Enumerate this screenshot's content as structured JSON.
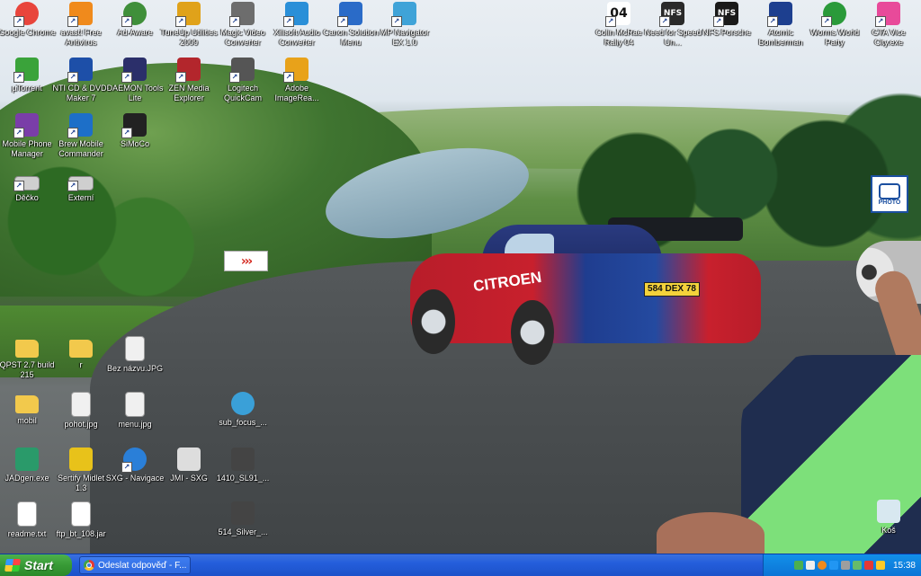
{
  "desktop": {
    "icons": [
      {
        "label": "Google Chrome",
        "icon": "chrome-icon",
        "color": "#e8453c",
        "shortcut": true
      },
      {
        "label": "avast! Free Antivirus",
        "icon": "avast-icon",
        "color": "#f08a1c",
        "shortcut": true
      },
      {
        "label": "Ad-Aware",
        "icon": "ad-aware-icon",
        "color": "#3f8f3a",
        "shortcut": true
      },
      {
        "label": "TuneUp Utilities 2009",
        "icon": "tuneup-icon",
        "color": "#e0a21a",
        "shortcut": true
      },
      {
        "label": "Magic Video Converter",
        "icon": "film-reel-icon",
        "color": "#6d6d6d",
        "shortcut": true
      },
      {
        "label": "Xilisoft Audio Converter",
        "icon": "audio-converter-icon",
        "color": "#2a8fd8",
        "shortcut": true
      },
      {
        "label": "Canon Solution Menu",
        "icon": "canon-icon",
        "color": "#2a6bc8",
        "shortcut": true
      },
      {
        "label": "MP Navigator EX 1.0",
        "icon": "mp-navigator-icon",
        "color": "#3fa3d8",
        "shortcut": true
      },
      {
        "label": "µTorrent",
        "icon": "utorrent-icon",
        "color": "#3aa33a",
        "shortcut": true
      },
      {
        "label": "NTI CD & DVD-Maker 7",
        "icon": "nti-icon",
        "color": "#1d4fa8",
        "shortcut": true
      },
      {
        "label": "DAEMON Tools Lite",
        "icon": "daemon-tools-icon",
        "color": "#2b2f6a",
        "shortcut": true
      },
      {
        "label": "ZEN Media Explorer",
        "icon": "zen-media-icon",
        "color": "#b3262c",
        "shortcut": true
      },
      {
        "label": "Logitech QuickCam",
        "icon": "webcam-icon",
        "color": "#555555",
        "shortcut": true
      },
      {
        "label": "Adobe ImageRea...",
        "icon": "adobe-icon",
        "color": "#e8a21a",
        "shortcut": true
      },
      {
        "label": "Mobile Phone Manager",
        "icon": "mpm-icon",
        "color": "#7a3ea8",
        "shortcut": true
      },
      {
        "label": "Brew Mobile Commander",
        "icon": "bmc-icon",
        "color": "#1d6fc8",
        "shortcut": true
      },
      {
        "label": "SiMoCo",
        "icon": "phone-icon",
        "color": "#222222",
        "shortcut": true
      },
      {
        "label": "Děčko",
        "icon": "drive-icon",
        "color": "#cfcfcf",
        "shortcut": true
      },
      {
        "label": "Externí",
        "icon": "drive-icon",
        "color": "#cfcfcf",
        "shortcut": true
      },
      {
        "label": "QPST 2.7 build 215",
        "icon": "folder-icon",
        "color": "#f2c94c",
        "shortcut": false
      },
      {
        "label": "r",
        "icon": "folder-icon",
        "color": "#f2c94c",
        "shortcut": false
      },
      {
        "label": "Bez názvu.JPG",
        "icon": "image-file-icon",
        "color": "#f0f0f0",
        "shortcut": false
      },
      {
        "label": "mobil",
        "icon": "folder-icon",
        "color": "#f2c94c",
        "shortcut": false
      },
      {
        "label": "pohot.jpg",
        "icon": "image-file-icon",
        "color": "#f0f0f0",
        "shortcut": false
      },
      {
        "label": "menu.jpg",
        "icon": "image-file-icon",
        "color": "#f0f0f0",
        "shortcut": false
      },
      {
        "label": "sub_focus_...",
        "icon": "media-file-icon",
        "color": "#3aa0d8",
        "shortcut": false
      },
      {
        "label": "JADgen.exe",
        "icon": "jadgen-icon",
        "color": "#2a9a6a",
        "shortcut": false
      },
      {
        "label": "Sertify Midlet 1.3",
        "icon": "star-icon",
        "color": "#e8c21a",
        "shortcut": false
      },
      {
        "label": "SXG - Navigace",
        "icon": "internet-explorer-icon",
        "color": "#2a7fd8",
        "shortcut": true
      },
      {
        "label": "JMI - SXG",
        "icon": "phone-icon",
        "color": "#dddddd",
        "shortcut": false
      },
      {
        "label": "1410_SL91_...",
        "icon": "archive-icon",
        "color": "#444444",
        "shortcut": false
      },
      {
        "label": "readme.txt",
        "icon": "text-file-icon",
        "color": "#ffffff",
        "shortcut": false
      },
      {
        "label": "ftp_bt_108.jar",
        "icon": "jar-file-icon",
        "color": "#ffffff",
        "shortcut": false
      },
      {
        "label": "514_Silver_...",
        "icon": "archive-icon",
        "color": "#444444",
        "shortcut": false
      },
      {
        "label": "Colin McRae Rally 04",
        "icon": "colin-mcrae-icon",
        "color": "#ffffff",
        "glyph_text": "04",
        "shortcut": true
      },
      {
        "label": "Need for Speed Un...",
        "icon": "nfs-icon",
        "color": "#2a2a2a",
        "glyph_text": "NFS",
        "shortcut": true
      },
      {
        "label": "NFS Porsche",
        "icon": "nfs-porsche-icon",
        "color": "#1a1a1a",
        "glyph_text": "NFS",
        "shortcut": true
      },
      {
        "label": "Atomic Bomberman",
        "icon": "bomberman-icon",
        "color": "#1d3f8f",
        "shortcut": true
      },
      {
        "label": "Worms World Party",
        "icon": "worms-icon",
        "color": "#2a9a3a",
        "shortcut": true
      },
      {
        "label": "GTA Vice City.exe",
        "icon": "gta-icon",
        "color": "#e84a9a",
        "shortcut": true
      },
      {
        "label": "Koš",
        "icon": "recycle-bin-icon",
        "color": "#d8e8f0",
        "shortcut": false
      }
    ]
  },
  "wallpaper": {
    "plate_text": "584 DEX 78",
    "car_brand": "CITROEN",
    "photo_sign": "PHOTO"
  },
  "taskbar": {
    "start_label": "Start",
    "task_items": [
      {
        "label": "Odeslat odpověď - F...",
        "icon": "chrome-icon"
      }
    ],
    "tray_icons": [
      "network-icon",
      "volume-icon",
      "antivirus-icon",
      "bluetooth-icon",
      "usb-icon",
      "battery-icon",
      "shield-icon",
      "sync-icon"
    ],
    "clock": "15:38"
  },
  "colors": {
    "taskbar_blue": "#245edb",
    "start_green": "#389a36",
    "tray_blue": "#0c74d6"
  }
}
